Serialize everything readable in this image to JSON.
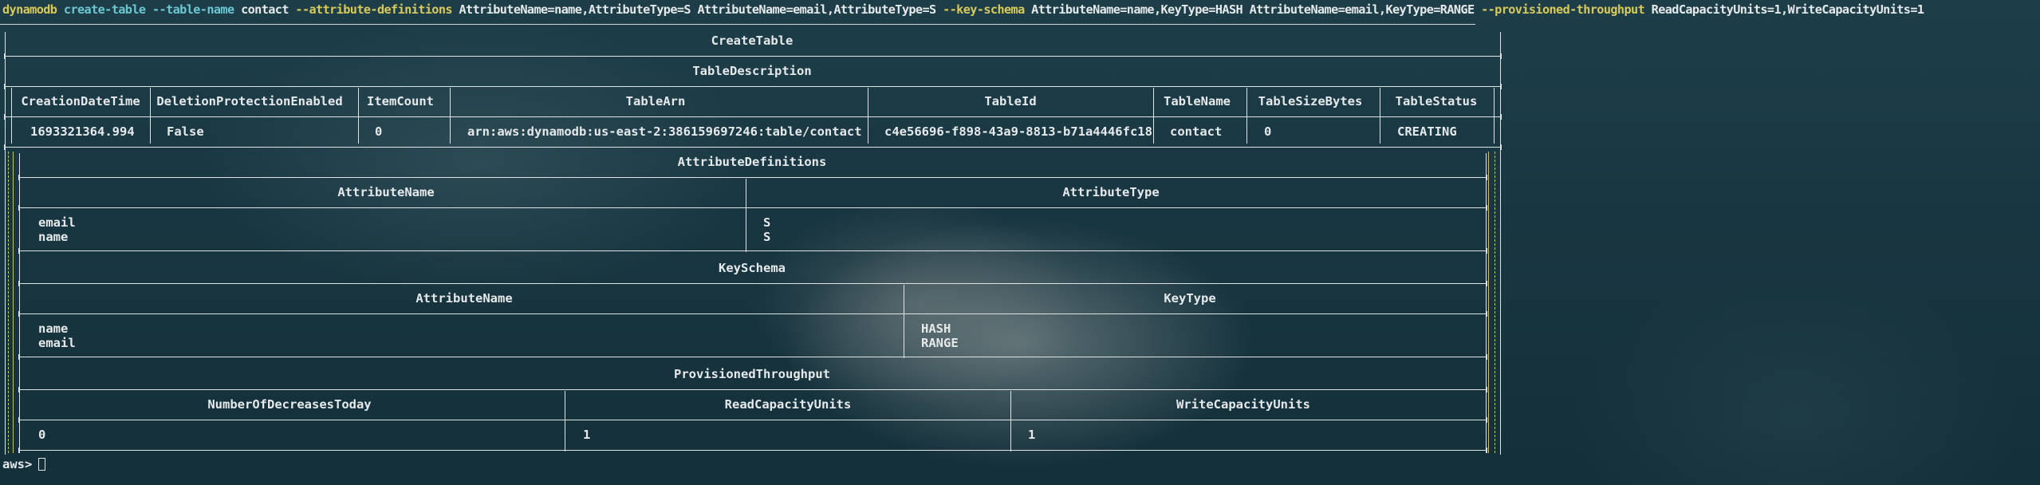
{
  "command": {
    "program": "dynamodb",
    "subcommand": "create-table",
    "args": [
      {
        "flag": "--table-name",
        "value": "contact"
      },
      {
        "flag": "--attribute-definitions",
        "value": "AttributeName=name,AttributeType=S AttributeName=email,AttributeType=S"
      },
      {
        "flag": "--key-schema",
        "value": "AttributeName=name,KeyType=HASH AttributeName=email,KeyType=RANGE"
      },
      {
        "flag": "--provisioned-throughput",
        "value": "ReadCapacityUnits=1,WriteCapacityUnits=1"
      }
    ]
  },
  "output": {
    "title": "CreateTable",
    "table_description": {
      "title": "TableDescription",
      "columns": [
        "CreationDateTime",
        "DeletionProtectionEnabled",
        "ItemCount",
        "TableArn",
        "TableId",
        "TableName",
        "TableSizeBytes",
        "TableStatus"
      ],
      "row": [
        "1693321364.994",
        "False",
        "0",
        "arn:aws:dynamodb:us-east-2:386159697246:table/contact",
        "c4e56696-f898-43a9-8813-b71a4446fc18",
        "contact",
        "0",
        "CREATING"
      ]
    },
    "attribute_definitions": {
      "title": "AttributeDefinitions",
      "columns": [
        "AttributeName",
        "AttributeType"
      ],
      "rows": [
        [
          "email",
          "S"
        ],
        [
          "name",
          "S"
        ]
      ]
    },
    "key_schema": {
      "title": "KeySchema",
      "columns": [
        "AttributeName",
        "KeyType"
      ],
      "rows": [
        [
          "name",
          "HASH"
        ],
        [
          "email",
          "RANGE"
        ]
      ]
    },
    "provisioned_throughput": {
      "title": "ProvisionedThroughput",
      "columns": [
        "NumberOfDecreasesToday",
        "ReadCapacityUnits",
        "WriteCapacityUnits"
      ],
      "row": [
        "0",
        "1",
        "1"
      ]
    }
  },
  "prompt": "aws>",
  "colors": {
    "flag": "#d8c95b",
    "subcommand": "#6cc7d3",
    "text": "#e6e9ea",
    "rule": "#dfe3e4",
    "nest_rule": "#c9c45a"
  }
}
